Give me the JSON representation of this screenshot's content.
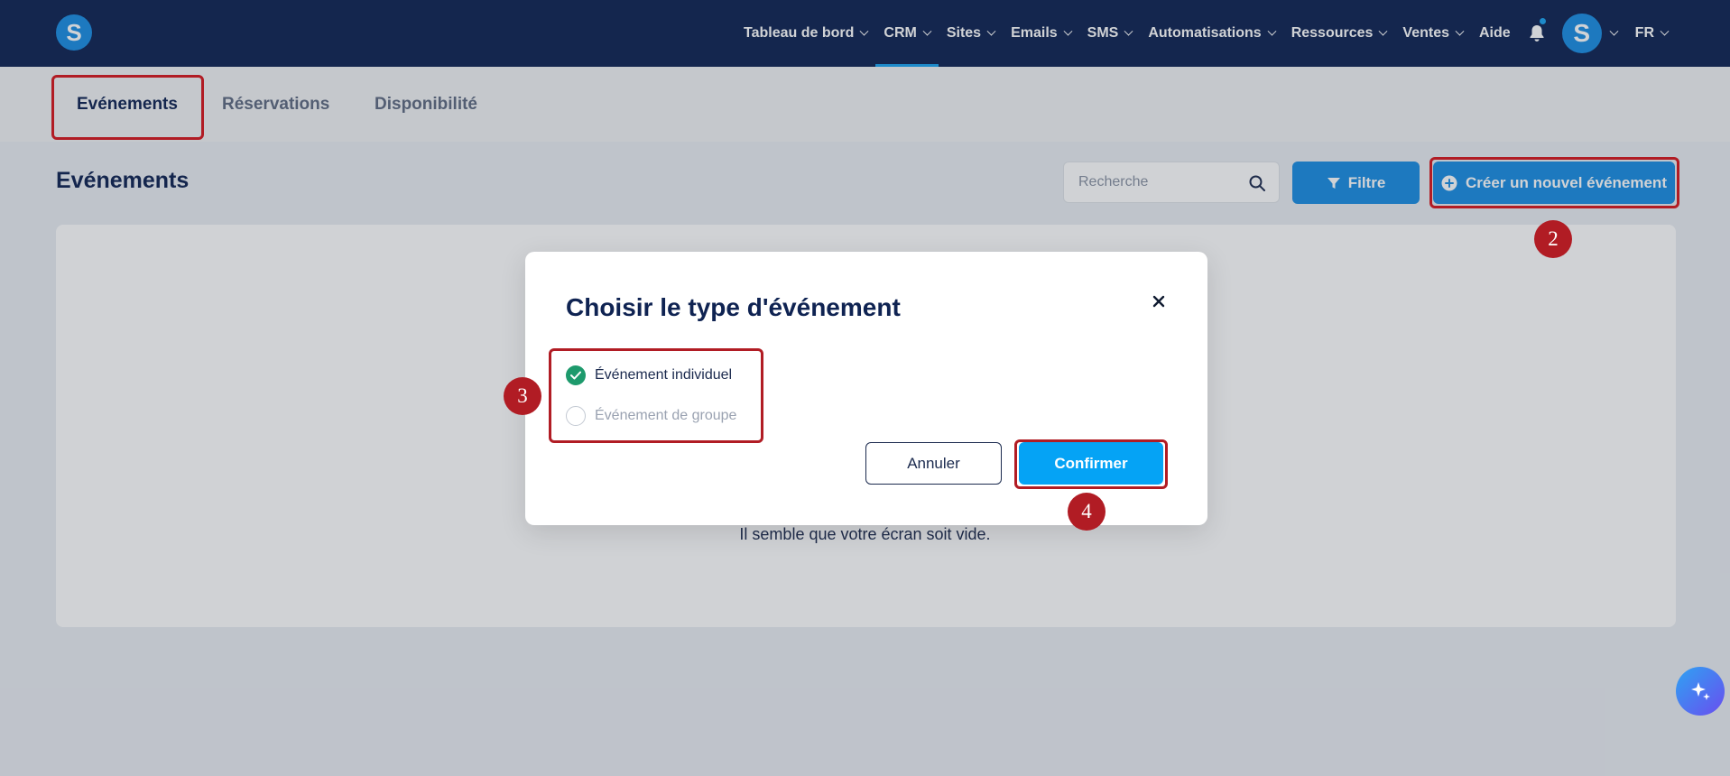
{
  "brand": {
    "logo_letter": "S"
  },
  "nav": {
    "items": [
      {
        "label": "Tableau de bord",
        "has_menu": true,
        "active": false
      },
      {
        "label": "CRM",
        "has_menu": true,
        "active": true
      },
      {
        "label": "Sites",
        "has_menu": true,
        "active": false
      },
      {
        "label": "Emails",
        "has_menu": true,
        "active": false
      },
      {
        "label": "SMS",
        "has_menu": true,
        "active": false
      },
      {
        "label": "Automatisations",
        "has_menu": true,
        "active": false
      },
      {
        "label": "Ressources",
        "has_menu": true,
        "active": false
      },
      {
        "label": "Ventes",
        "has_menu": true,
        "active": false
      },
      {
        "label": "Aide",
        "has_menu": false,
        "active": false
      }
    ],
    "avatar_letter": "S",
    "language": "FR"
  },
  "tabs": [
    {
      "label": "Evénements",
      "active": true
    },
    {
      "label": "Réservations",
      "active": false
    },
    {
      "label": "Disponibilité",
      "active": false
    }
  ],
  "page": {
    "title": "Evénements",
    "search_placeholder": "Recherche",
    "filter_label": "Filtre",
    "create_label": "Créer un nouvel événement",
    "empty_text": "Il semble que votre écran soit vide."
  },
  "modal": {
    "title": "Choisir le type d'événement",
    "options": [
      {
        "label": "Événement individuel",
        "checked": true
      },
      {
        "label": "Événement de groupe",
        "checked": false
      }
    ],
    "cancel_label": "Annuler",
    "confirm_label": "Confirmer"
  },
  "annotations": [
    "2",
    "3",
    "4"
  ],
  "colors": {
    "nav_bg": "#0f2352",
    "primary": "#1a8de3",
    "confirm": "#05a3f5",
    "highlight": "#b11c24",
    "success": "#1d9a6c"
  }
}
